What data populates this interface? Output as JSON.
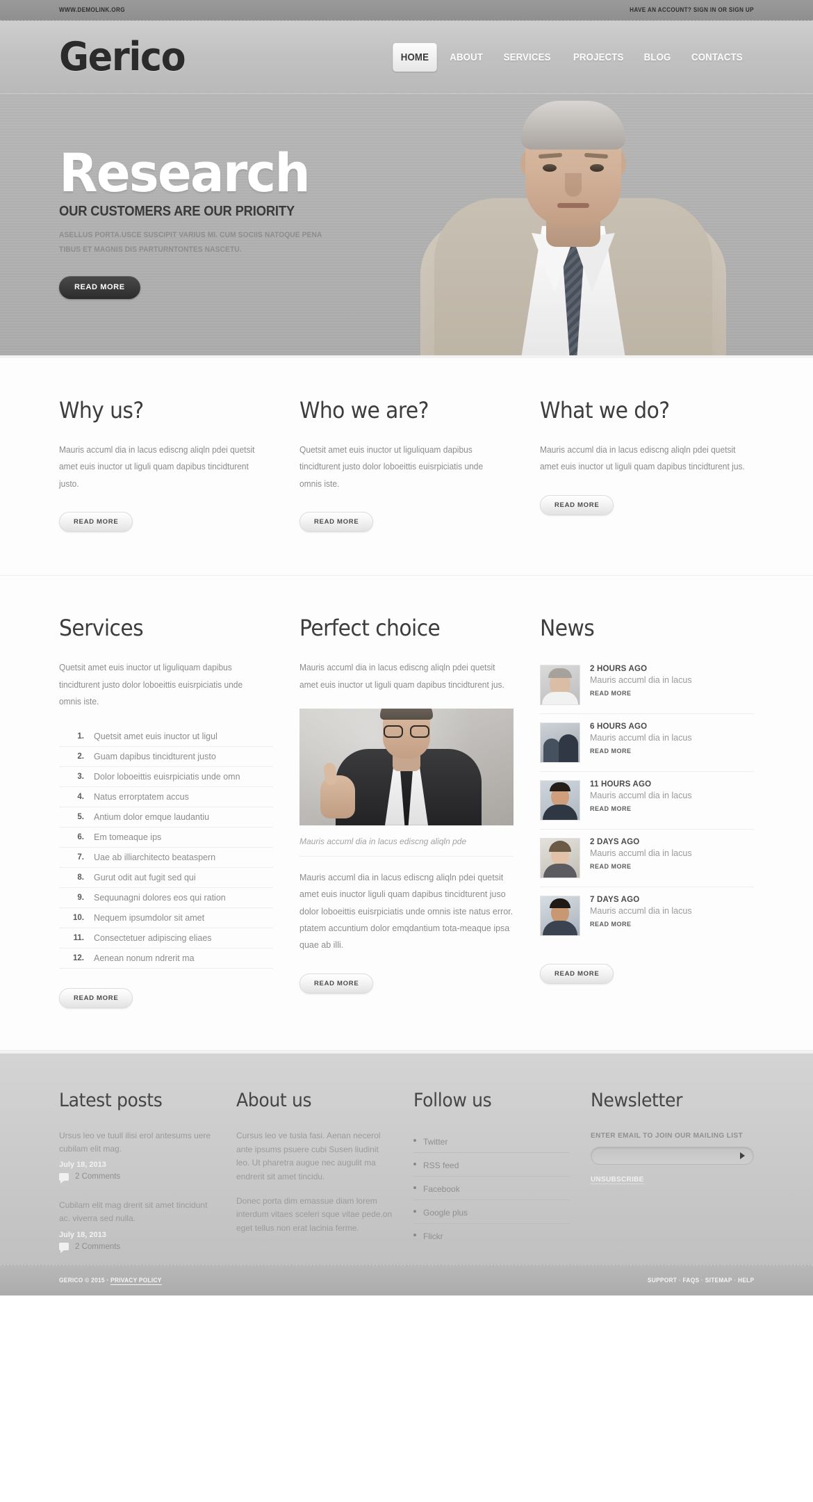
{
  "topbar": {
    "site_url": "WWW.DEMOLINK.ORG",
    "account_text": "HAVE AN ACCOUNT? SIGN IN OR SIGN UP"
  },
  "header": {
    "logo": "Gerico",
    "nav": [
      {
        "label": "HOME",
        "active": true
      },
      {
        "label": "ABOUT",
        "active": false
      },
      {
        "label": "SERVICES",
        "active": false
      },
      {
        "label": "PROJECTS",
        "active": false
      },
      {
        "label": "BLOG",
        "active": false
      },
      {
        "label": "CONTACTS",
        "active": false
      }
    ]
  },
  "hero": {
    "title": "Research",
    "subtitle": "OUR CUSTOMERS ARE OUR PRIORITY",
    "description": "ASELLUS PORTA.USCE SUSCIPIT VARIUS MI. CUM SOCIIS NATOQUE PENA TIBUS ET MAGNIS DIS PARTURNTONTES NASCETU.",
    "cta": "READ MORE",
    "photo_alt": "businessman-portrait"
  },
  "features": [
    {
      "title": "Why us?",
      "text": "Mauris accuml dia in lacus ediscng aliqln pdei quetsit amet euis inuctor ut liguli quam dapibus tincidturent justo.",
      "cta": "READ MORE"
    },
    {
      "title": "Who we are?",
      "text": "Quetsit amet euis inuctor ut liguliquam dapibus tincidturent justo dolor loboeittis euisrpiciatis unde omnis iste.",
      "cta": "READ MORE"
    },
    {
      "title": "What we do?",
      "text": "Mauris accuml dia in lacus ediscng aliqln pdei quetsit amet euis inuctor ut liguli quam dapibus tincidturent jus.",
      "cta": "READ MORE"
    }
  ],
  "services": {
    "title": "Services",
    "intro": "Quetsit amet euis inuctor ut liguliquam dapibus tincidturent justo dolor loboeittis euisrpiciatis unde omnis iste.",
    "items": [
      "Quetsit amet euis inuctor ut ligul",
      "Guam dapibus tincidturent justo",
      "Dolor loboeittis euisrpiciatis unde omn",
      "Natus errorptatem accus",
      "Antium dolor emque laudantiu",
      "Em tomeaque ips",
      "Uae ab illiarchitecto beataspern",
      "Gurut odit aut fugit sed qui",
      "Sequunagni dolores eos qui ration",
      "Nequem ipsumdolor sit amet",
      "Consectetuer adipiscing eliaes",
      "Aenean nonum ndrerit ma"
    ],
    "cta": "READ MORE"
  },
  "perfect_choice": {
    "title": "Perfect choice",
    "intro": "Mauris accuml dia in lacus ediscng aliqln pdei quetsit amet euis inuctor ut liguli quam dapibus tincidturent jus.",
    "image_alt": "man-thumbs-up",
    "caption": "Mauris accuml dia in lacus ediscng aliqln pde",
    "text": "Mauris accuml dia in lacus ediscng aliqln pdei quetsit amet euis inuctor  liguli quam dapibus tincidturent juso dolor loboeittis euisrpiciatis unde omnis iste natus error. ptatem accuntium dolor emqdantium tota-meaque ipsa quae ab illi.",
    "cta": "READ MORE"
  },
  "news": {
    "title": "News",
    "items": [
      {
        "date": "2 HOURS AGO",
        "text": "Mauris accuml dia in lacus",
        "more": "READ MORE",
        "thumb": "man-glasses-portrait"
      },
      {
        "date": "6 HOURS AGO",
        "text": "Mauris accuml dia in lacus",
        "more": "READ MORE",
        "thumb": "business-team-profile"
      },
      {
        "date": "11 HOURS AGO",
        "text": "Mauris accuml dia in lacus",
        "more": "READ MORE",
        "thumb": "smiling-man-suit"
      },
      {
        "date": "2 DAYS AGO",
        "text": "Mauris accuml dia in lacus",
        "more": "READ MORE",
        "thumb": "businesswoman-portrait"
      },
      {
        "date": "7 DAYS AGO",
        "text": "Mauris accuml dia in lacus",
        "more": "READ MORE",
        "thumb": "young-man-portrait"
      }
    ],
    "cta": "READ MORE"
  },
  "footer": {
    "latest_posts": {
      "title": "Latest posts",
      "posts": [
        {
          "text": "Ursus leo ve tuull ilisi erol antesums uere cubilam elit mag.",
          "date": "July 18, 2013",
          "comments": "2 Comments"
        },
        {
          "text": "Cubilam elit mag drerit sit amet tincidunt ac. viverra sed nulla.",
          "date": "July 18, 2013",
          "comments": "2 Comments"
        }
      ]
    },
    "about": {
      "title": "About us",
      "paragraphs": [
        "Cursus leo ve tusla fasi. Aenan necerol ante ipsums psuere cubi Susen liudinit leo. Ut pharetra augue nec augulit ma endrerit sit amet tincidu.",
        "Donec porta dim emassue diam lorem interdum vitaes sceleri sque vitae pede.on eget tellus non erat lacinia ferme."
      ]
    },
    "follow": {
      "title": "Follow  us",
      "links": [
        "Twitter",
        "RSS feed",
        "Facebook",
        "Google plus",
        "Flickr"
      ]
    },
    "newsletter": {
      "title": "Newsletter",
      "label": "ENTER EMAIL TO JOIN OUR MAILING LIST",
      "input_value": "",
      "input_placeholder": "",
      "submit_icon": "play-arrow-icon",
      "unsubscribe": "UNSUBSCRIBE"
    }
  },
  "copyright": {
    "text": "GERICO © 2015 ·",
    "privacy": "PRIVACY POLICY",
    "links": [
      "SUPPORT",
      "FAQS",
      "SITEMAP",
      "HELP"
    ]
  }
}
